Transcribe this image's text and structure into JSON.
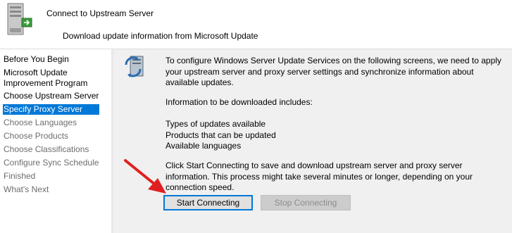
{
  "header": {
    "title": "Connect to Upstream Server",
    "subtitle": "Download update information from Microsoft Update",
    "icon": "server-connect-icon"
  },
  "sidebar": {
    "items": [
      {
        "label": "Before You Begin",
        "state": "done"
      },
      {
        "label": "Microsoft Update\nImprovement Program",
        "state": "done"
      },
      {
        "label": "Choose Upstream Server",
        "state": "done"
      },
      {
        "label": "Specify Proxy Server",
        "state": "active"
      },
      {
        "label": "Choose Languages",
        "state": "pending"
      },
      {
        "label": "Choose Products",
        "state": "pending"
      },
      {
        "label": "Choose Classifications",
        "state": "pending"
      },
      {
        "label": "Configure Sync Schedule",
        "state": "pending"
      },
      {
        "label": "Finished",
        "state": "pending"
      },
      {
        "label": "What's Next",
        "state": "pending"
      }
    ]
  },
  "main": {
    "icon": "sync-server-icon",
    "intro": "To configure Windows Server Update Services on the following screens, we need to apply your upstream server and proxy server settings and synchronize information about available updates.",
    "info_heading": "Information to be downloaded includes:",
    "info_items": [
      "Types of updates available",
      "Products that can be updated",
      "Available languages"
    ],
    "instructions": "Click Start Connecting to save and download upstream server and proxy server information. This process might take several minutes or longer, depending on your connection speed.",
    "start_button": "Start Connecting",
    "stop_button": "Stop Connecting"
  },
  "colors": {
    "accent": "#0078d7",
    "annotation_arrow": "#e02020",
    "content_background": "#f0f0f0"
  }
}
